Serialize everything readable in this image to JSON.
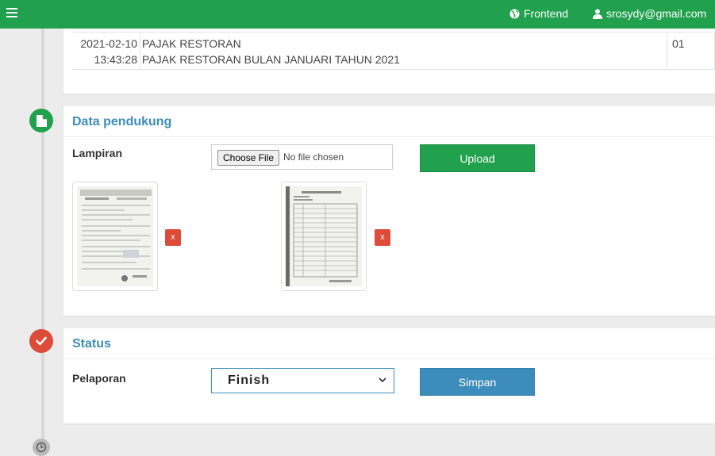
{
  "topbar": {
    "frontend_label": "Frontend",
    "user_email": "srosydy@gmail.com",
    "color": "#21a04e"
  },
  "record": {
    "date": "2021-02-10",
    "time": "13:43:28",
    "tax_type": "PAJAK RESTORAN",
    "description": "PAJAK RESTORAN BULAN JANUARI TAHUN 2021",
    "code": "01"
  },
  "data_pendukung": {
    "title": "Data pendukung",
    "attachment_label": "Lampiran",
    "choose_file_label": "Choose File",
    "no_file_text": "No file chosen",
    "upload_label": "Upload",
    "delete_label": "x"
  },
  "status": {
    "title": "Status",
    "report_label": "Pelaporan",
    "selected_value": "Finish",
    "save_label": "Simpan"
  },
  "colors": {
    "accent_green": "#21a04e",
    "accent_blue": "#3c8dbc",
    "danger_red": "#dd4b39"
  }
}
